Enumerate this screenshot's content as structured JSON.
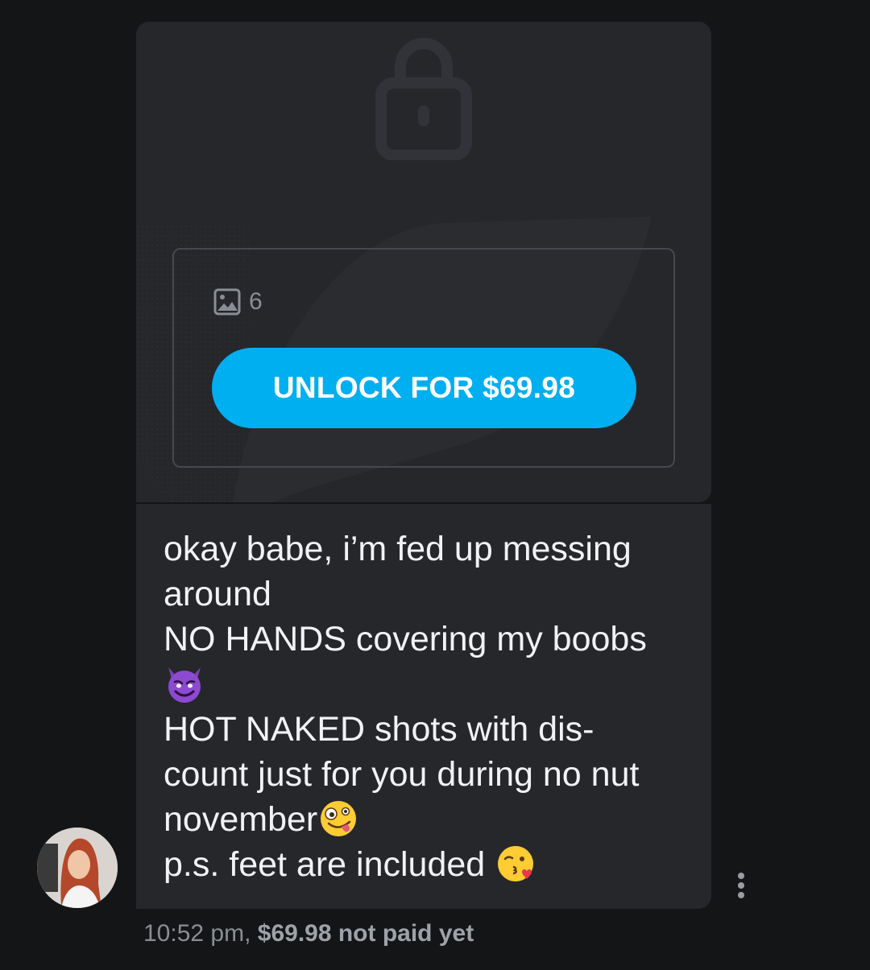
{
  "message": {
    "media": {
      "count": "6",
      "unlock_label": "UNLOCK FOR $69.98",
      "icons": [
        "lock-icon",
        "image-icon"
      ]
    },
    "text_lines": [
      "okay babe, i’m fed up messing",
      "around",
      "NO HANDS covering my boobs",
      "HOT NAKED shots with dis-",
      "count just for you during no nut",
      "november",
      "p.s. feet are included"
    ],
    "emojis": [
      "smiling-devil-emoji",
      "zany-face-emoji",
      "face-blowing-kiss-emoji"
    ],
    "meta": {
      "time": "10:52 pm,",
      "price_status": "$69.98 not paid yet"
    }
  },
  "colors": {
    "background": "#141517",
    "bubble": "#25272b",
    "accent": "#00aff0",
    "text": "#f1f2f3",
    "muted": "#8a8e94"
  }
}
